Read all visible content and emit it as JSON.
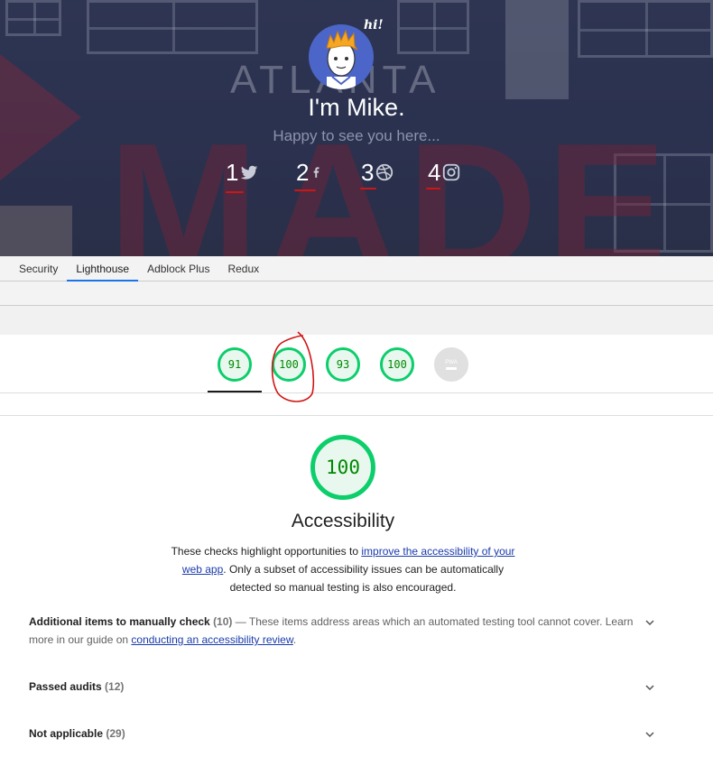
{
  "hero": {
    "title": "I'm Mike.",
    "subtitle": "Happy to see you here...",
    "greeting": "hi!",
    "background_text": "ATLANTA",
    "background_text_2": "MADE",
    "social": [
      {
        "number": "1",
        "icon": "twitter-icon"
      },
      {
        "number": "2",
        "icon": "facebook-icon"
      },
      {
        "number": "3",
        "icon": "dribbble-icon"
      },
      {
        "number": "4",
        "icon": "instagram-icon"
      }
    ]
  },
  "devtools": {
    "tabs": [
      {
        "label": "Security",
        "active": false
      },
      {
        "label": "Lighthouse",
        "active": true
      },
      {
        "label": "Adblock Plus",
        "active": false
      },
      {
        "label": "Redux",
        "active": false
      }
    ]
  },
  "gauges": [
    {
      "score": "91",
      "category": "performance"
    },
    {
      "score": "100",
      "category": "accessibility"
    },
    {
      "score": "93",
      "category": "best-practices"
    },
    {
      "score": "100",
      "category": "seo"
    },
    {
      "score": "",
      "category": "pwa",
      "label": "PWA"
    }
  ],
  "category": {
    "score": "100",
    "title": "Accessibility",
    "desc_before": "These checks highlight opportunities to ",
    "desc_link": "improve the accessibility of your web app",
    "desc_after": ". Only a subset of accessibility issues can be automatically detected so manual testing is also encouraged."
  },
  "groups": {
    "manual": {
      "title": "Additional items to manually check",
      "count": "(10)",
      "desc_before": " — These items address areas which an automated testing tool cannot cover. Learn more in our guide on ",
      "link": "conducting an accessibility review",
      "desc_after": "."
    },
    "passed": {
      "title": "Passed audits",
      "count": "(12)"
    },
    "not_applicable": {
      "title": "Not applicable",
      "count": "(29)"
    }
  },
  "colors": {
    "pass_green": "#0cce6b",
    "pass_text": "#008800",
    "link": "#1a3bab",
    "annotation_red": "#d01515",
    "hero_bg": "#2b3250",
    "avatar_bg": "#4c65c8"
  }
}
